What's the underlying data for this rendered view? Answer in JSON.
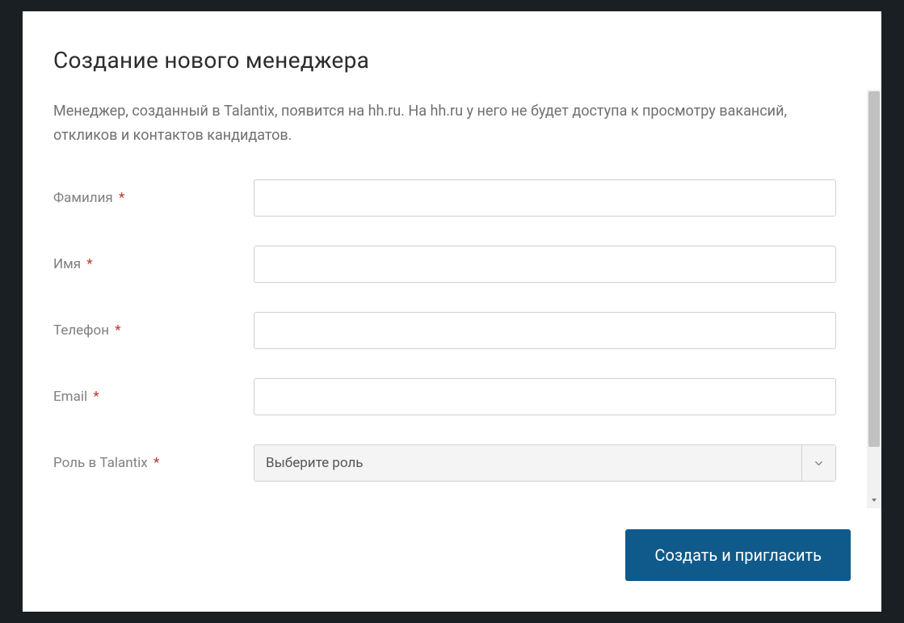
{
  "modal": {
    "title": "Создание нового менеджера",
    "description": "Менеджер, созданный в Talantix, появится на hh.ru. На hh.ru у него не будет доступа к просмотру вакансий, откликов и контактов кандидатов.",
    "fields": {
      "lastname": {
        "label": "Фамилия",
        "required": true,
        "value": ""
      },
      "firstname": {
        "label": "Имя",
        "required": true,
        "value": ""
      },
      "phone": {
        "label": "Телефон",
        "required": true,
        "value": ""
      },
      "email": {
        "label": "Email",
        "required": true,
        "value": ""
      },
      "role": {
        "label": "Роль в Talantix",
        "required": true,
        "placeholder": "Выберите роль",
        "selected": ""
      }
    },
    "submit_label": "Создать и пригласить"
  },
  "colors": {
    "primary": "#0f5a8a",
    "required": "#c0392b"
  }
}
